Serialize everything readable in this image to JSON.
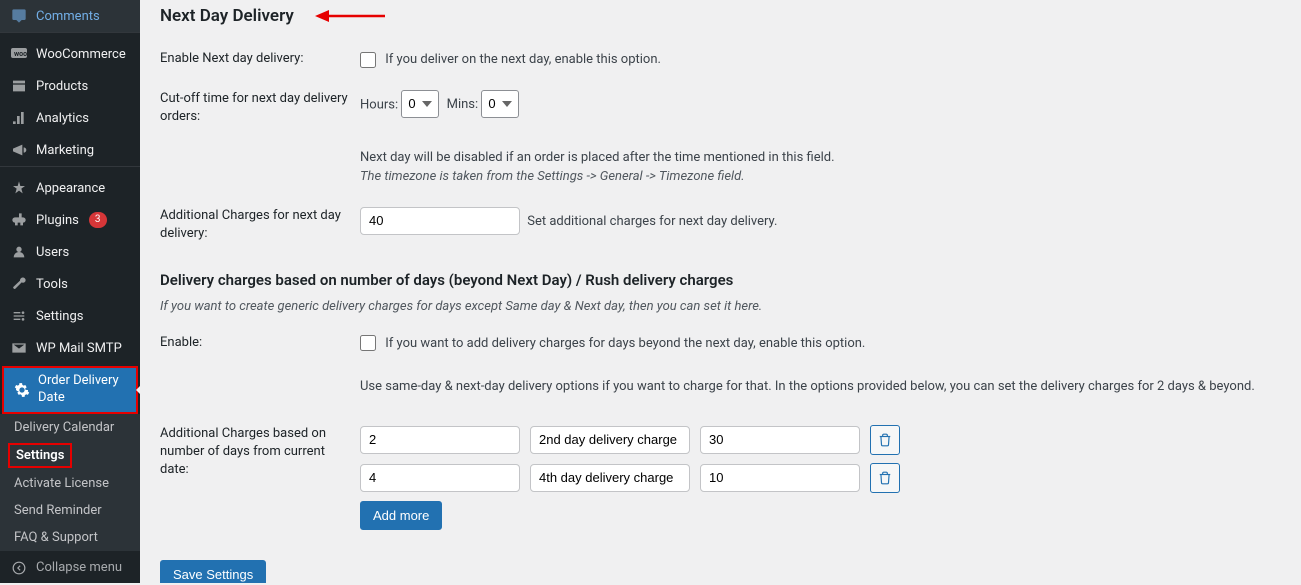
{
  "sidebar": {
    "items": [
      {
        "label": "Comments",
        "icon": "comments"
      },
      {
        "label": "WooCommerce",
        "icon": "woo"
      },
      {
        "label": "Products",
        "icon": "products"
      },
      {
        "label": "Analytics",
        "icon": "analytics"
      },
      {
        "label": "Marketing",
        "icon": "marketing"
      },
      {
        "label": "Appearance",
        "icon": "appearance"
      },
      {
        "label": "Plugins",
        "icon": "plugins",
        "badge": "3"
      },
      {
        "label": "Users",
        "icon": "users"
      },
      {
        "label": "Tools",
        "icon": "tools"
      },
      {
        "label": "Settings",
        "icon": "settings"
      },
      {
        "label": "WP Mail SMTP",
        "icon": "mail"
      },
      {
        "label": "Order Delivery Date",
        "icon": "gear",
        "active": true
      }
    ],
    "sub": [
      {
        "label": "Delivery Calendar"
      },
      {
        "label": "Settings",
        "highlight": true
      },
      {
        "label": "Activate License"
      },
      {
        "label": "Send Reminder"
      },
      {
        "label": "FAQ & Support"
      }
    ],
    "collapse": "Collapse menu"
  },
  "section_title": "Next Day Delivery",
  "enable_next_day": {
    "label": "Enable Next day delivery:",
    "desc": "If you deliver on the next day, enable this option."
  },
  "cutoff": {
    "label": "Cut-off time for next day delivery orders:",
    "hours_label": "Hours:",
    "hours_value": "0",
    "mins_label": "Mins:",
    "mins_value": "0",
    "desc": "Next day will be disabled if an order is placed after the time mentioned in this field.",
    "note": "The timezone is taken from the Settings -> General -> Timezone field."
  },
  "additional_next_day": {
    "label": "Additional Charges for next day delivery:",
    "value": "40",
    "desc": "Set additional charges for next day delivery."
  },
  "rush_title": "Delivery charges based on number of days (beyond Next Day) / Rush delivery charges",
  "rush_subtitle": "If you want to create generic delivery charges for days except Same day & Next day, then you can set it here.",
  "rush_enable": {
    "label": "Enable:",
    "desc": "If you want to add delivery charges for days beyond the next day, enable this option.",
    "note": "Use same-day & next-day delivery options if you want to charge for that. In the options provided below, you can set the delivery charges for 2 days & beyond."
  },
  "charges": {
    "label": "Additional Charges based on number of days from current date:",
    "rows": [
      {
        "days": "2",
        "label": "2nd day delivery charge",
        "amount": "30"
      },
      {
        "days": "4",
        "label": "4th day delivery charge",
        "amount": "10"
      }
    ],
    "add_more": "Add more"
  },
  "save": "Save Settings"
}
